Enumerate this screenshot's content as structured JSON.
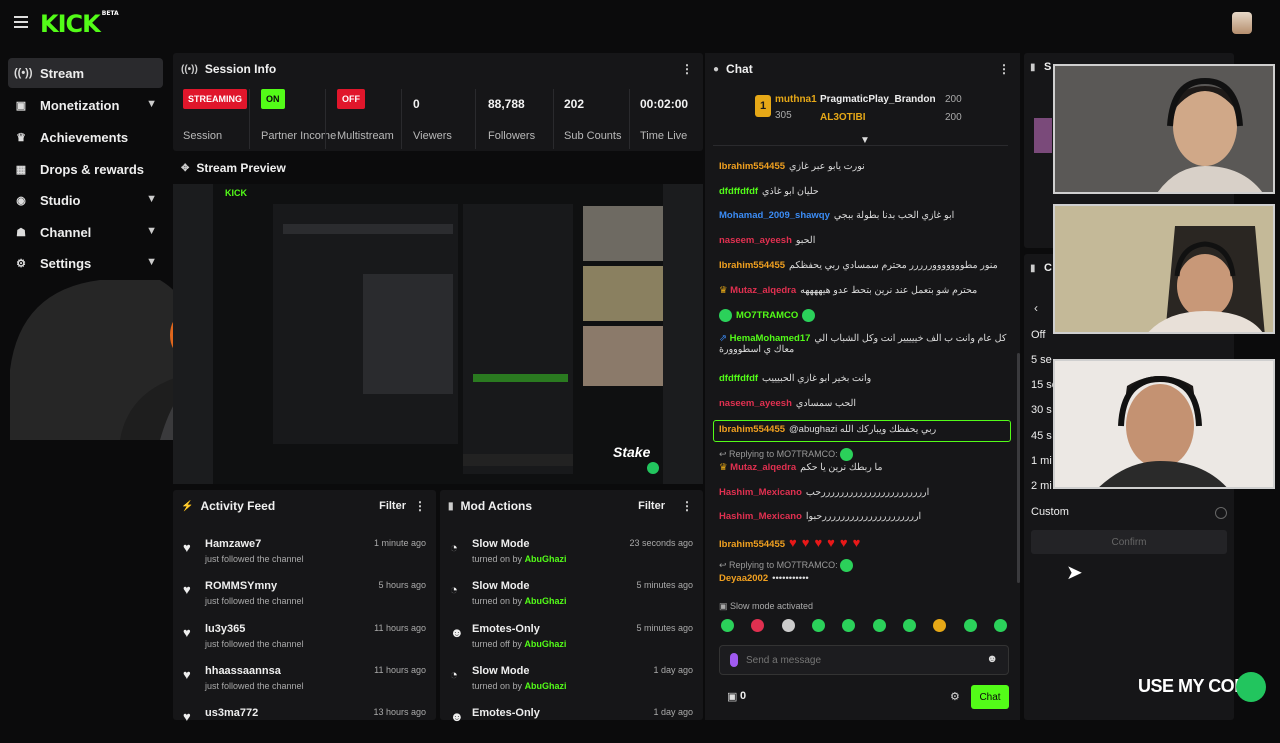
{
  "brand": {
    "logo": "KICK",
    "tag": "BETA",
    "accent": "#53fc18"
  },
  "sidebar": {
    "items": [
      {
        "label": "Stream",
        "icon": "stream-icon",
        "active": true
      },
      {
        "label": "Monetization",
        "icon": "monetization-icon",
        "expandable": true
      },
      {
        "label": "Achievements",
        "icon": "trophy-icon"
      },
      {
        "label": "Drops & rewards",
        "icon": "gift-icon"
      },
      {
        "label": "Studio",
        "icon": "studio-icon",
        "expandable": true
      },
      {
        "label": "Channel",
        "icon": "channel-icon",
        "expandable": true
      },
      {
        "label": "Settings",
        "icon": "gear-icon",
        "expandable": true
      }
    ]
  },
  "session": {
    "title": "Session Info",
    "streaming_badge": "STREAMING",
    "session_label": "Session",
    "partner_badge": "ON",
    "partner_label": "Partner Income",
    "multistream_badge": "OFF",
    "multistream_label": "Multistream",
    "viewers": "0",
    "viewers_label": "Viewers",
    "followers": "88,788",
    "followers_label": "Followers",
    "subs": "202",
    "subs_label": "Sub Counts",
    "time_live": "00:02:00",
    "time_label": "Time Live"
  },
  "preview": {
    "title": "Stream Preview",
    "overlay_brand": "Stake"
  },
  "activity": {
    "title": "Activity Feed",
    "filter": "Filter",
    "items": [
      {
        "name": "Hamzawe7",
        "desc": "just followed the channel",
        "time": "1 minute ago"
      },
      {
        "name": "ROMMSYmny",
        "desc": "just followed the channel",
        "time": "5 hours ago"
      },
      {
        "name": "lu3y365",
        "desc": "just followed the channel",
        "time": "11 hours ago"
      },
      {
        "name": "hhaassaannsa",
        "desc": "just followed the channel",
        "time": "11 hours ago"
      },
      {
        "name": "us3ma772",
        "desc": "",
        "time": "13 hours ago"
      }
    ]
  },
  "mod_actions": {
    "title": "Mod Actions",
    "filter": "Filter",
    "items": [
      {
        "name": "Slow Mode",
        "desc": "turned on by",
        "by": "AbuGhazi",
        "time": "23 seconds ago"
      },
      {
        "name": "Slow Mode",
        "desc": "turned on by",
        "by": "AbuGhazi",
        "time": "5 minutes ago"
      },
      {
        "name": "Emotes-Only",
        "desc": "turned off by",
        "by": "AbuGhazi",
        "time": "5 minutes ago"
      },
      {
        "name": "Slow Mode",
        "desc": "turned on by",
        "by": "AbuGhazi",
        "time": "1 day ago"
      },
      {
        "name": "Emotes-Only",
        "desc": "",
        "by": "",
        "time": "1 day ago"
      }
    ]
  },
  "chat": {
    "title": "Chat",
    "leaderboard": {
      "rank": "1",
      "top_user": "muthna1",
      "top_score": "305",
      "gift1_user": "PragmaticPlay_Brandon",
      "gift1_amount": "200",
      "gift2_user": "AL3OTIBI",
      "gift2_amount": "200"
    },
    "messages": [
      {
        "user": "Ibrahim554455",
        "color": "#f0a020",
        "text": "نورت يابو عبر غازي"
      },
      {
        "user": "dfdffdfdf",
        "color": "#53fc18",
        "text": "حليان ابو غاذي"
      },
      {
        "user": "Mohamad_2009_shawqy",
        "color": "#3b8cf5",
        "text": "ابو غازي الحب بدنا بطولة ببجي"
      },
      {
        "user": "naseem_ayeesh",
        "color": "#e03050",
        "text": "الحبو"
      },
      {
        "user": "Ibrahim554455",
        "color": "#f0a020",
        "text": "منور مطوووووووررررر محترم سمسادي ربي يحفظكم"
      },
      {
        "user": "Mutaz_alqedra",
        "color": "#e03050",
        "text": "محترم شو بتعمل عند نرين بتحط عدو هيههههه"
      },
      {
        "user": "MO7TRAMCO",
        "color": "#53fc18",
        "text": ""
      },
      {
        "user": "HemaMohamed17",
        "color": "#53fc18",
        "text": "كل عام وانت ب الف خييييير انت وكل الشباب الي معاك ي اسطووورة"
      },
      {
        "user": "dfdffdfdf",
        "color": "#53fc18",
        "text": "وانت بخير ابو غازي الحبيييب"
      },
      {
        "user": "naseem_ayeesh",
        "color": "#e03050",
        "text": "الحب سمسادي"
      },
      {
        "user": "Ibrahim554455",
        "color": "#f0a020",
        "text": "@abughazi ربي يحفظك ويباركك الله"
      },
      {
        "user": "Mutaz_alqedra",
        "color": "#e03050",
        "text": "ما ربطك نرين يا حكم"
      },
      {
        "user": "Hashim_Mexicano",
        "color": "#e03050",
        "text": "ارررررررررررررررررررررررحب"
      },
      {
        "user": "Hashim_Mexicano",
        "color": "#e03050",
        "text": "ارررررررررررررررررررررحبوا"
      },
      {
        "user": "Ibrahim554455",
        "color": "#f0a020",
        "text": ""
      },
      {
        "user": "Deyaa2002",
        "color": "#f0a020",
        "text": "•••••••••••"
      }
    ],
    "reply_prefix": "Replying to MO7TRAMCO:",
    "slow_mode_notice": "Slow mode activated",
    "placeholder": "Send a message",
    "points": "0",
    "send_label": "Chat"
  },
  "right_panel": {
    "header_char": "S",
    "header2_char": "C",
    "options": [
      "Off",
      "5 se",
      "15 se",
      "30 s",
      "45 s",
      "1 mi",
      "2 mi",
      "Custom"
    ],
    "confirm": "Confirm",
    "overlay_text": "USE MY CODE"
  }
}
